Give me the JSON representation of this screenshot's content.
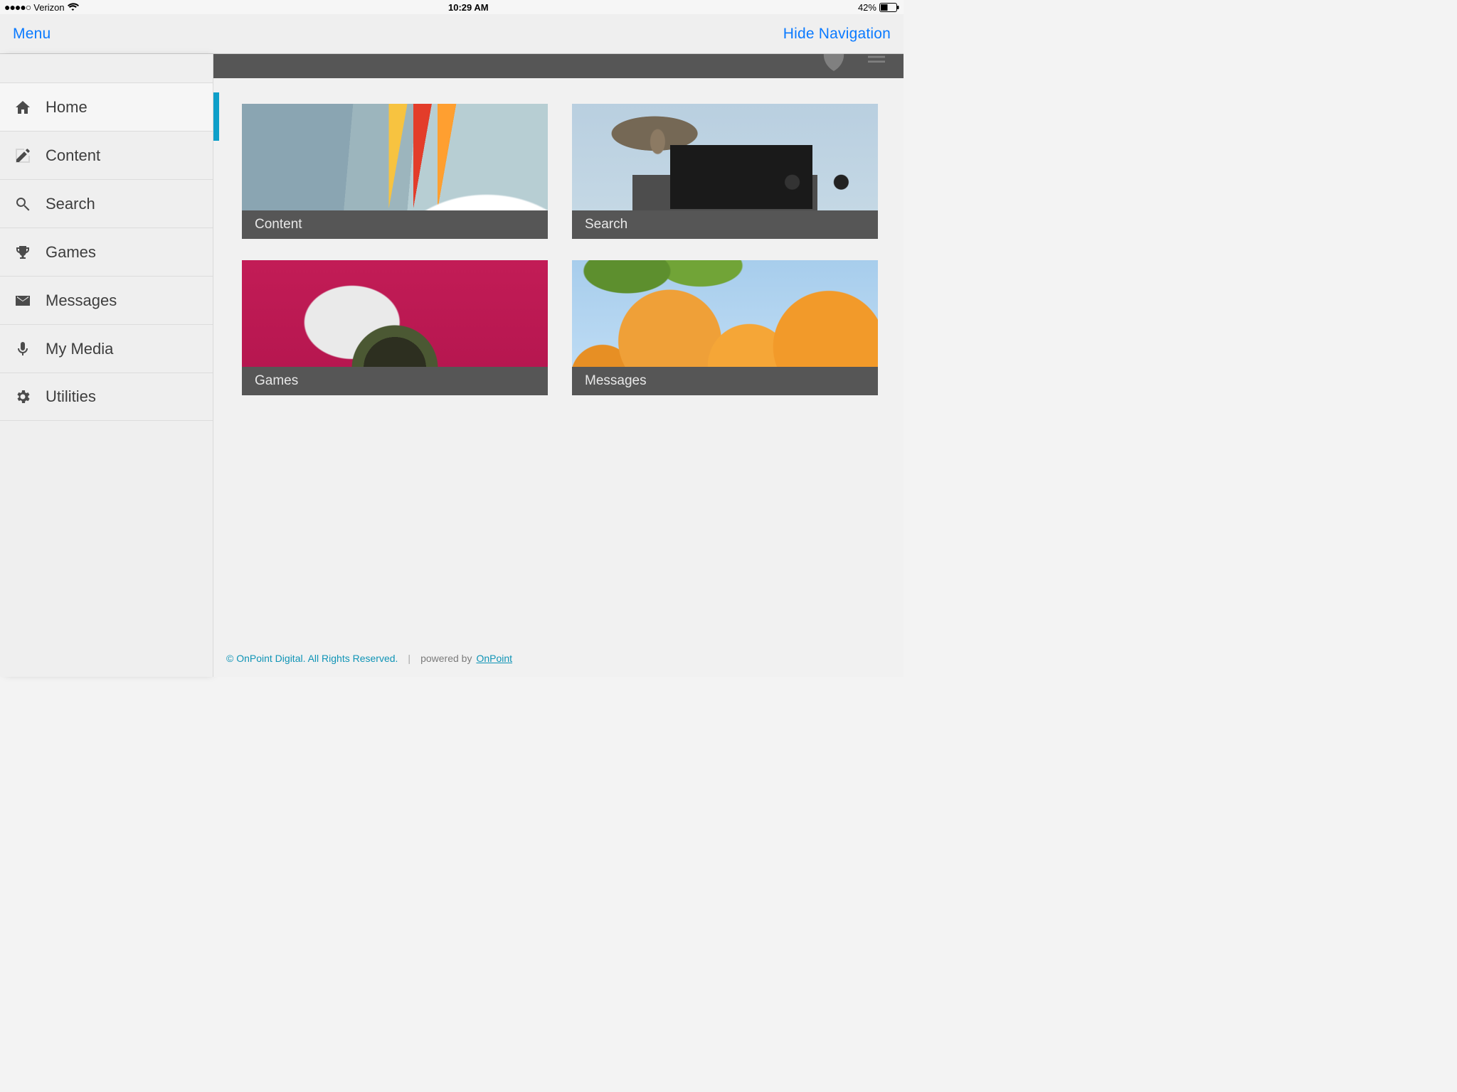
{
  "statusbar": {
    "carrier": "Verizon",
    "time": "10:29 AM",
    "battery_text": "42%"
  },
  "navbar": {
    "menu_label": "Menu",
    "hide_label": "Hide Navigation"
  },
  "sidebar": {
    "items": [
      {
        "label": "Home",
        "icon": "home-icon"
      },
      {
        "label": "Content",
        "icon": "edit-icon"
      },
      {
        "label": "Search",
        "icon": "search-icon"
      },
      {
        "label": "Games",
        "icon": "trophy-icon"
      },
      {
        "label": "Messages",
        "icon": "envelope-icon"
      },
      {
        "label": "My Media",
        "icon": "mic-icon"
      },
      {
        "label": "Utilities",
        "icon": "gear-icon"
      }
    ]
  },
  "tiles": [
    {
      "label": "Content",
      "image_hint": "colored pencils and notebook"
    },
    {
      "label": "Search",
      "image_hint": "bird on a camera"
    },
    {
      "label": "Games",
      "image_hint": "kitten with yarn ball"
    },
    {
      "label": "Messages",
      "image_hint": "oranges on a tree"
    }
  ],
  "footer": {
    "copyright": "© OnPoint Digital. All Rights Reserved.",
    "powered_prefix": "powered by",
    "powered_link": "OnPoint"
  }
}
